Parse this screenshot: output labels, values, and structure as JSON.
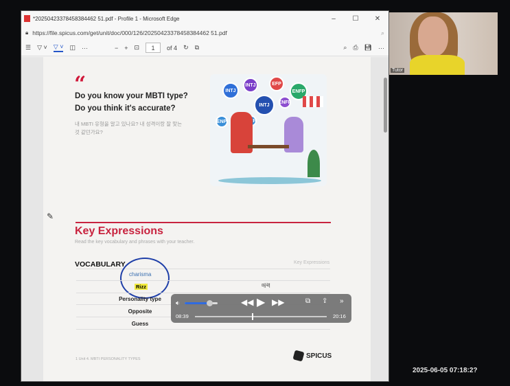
{
  "window": {
    "title": "*20250423378458384462 51.pdf - Profile 1 - Microsoft Edge",
    "url": "https://file.spicus.com/get/unit/doc/000/126/20250423378458384462 51.pdf"
  },
  "toolbar": {
    "page": "1",
    "of": "of 4"
  },
  "doc": {
    "q1": "Do you know your MBTI type?",
    "q2": "Do you think it's accurate?",
    "ko": "내 MBTI 유형을 알고 있나요? 내 성격이랑 잘 맞는 것 같던가요?",
    "bubbles": [
      "INTJ",
      "INTJ",
      "EFP",
      "ENFP",
      "INTJ",
      "ENP",
      "ENFP",
      "ENP"
    ],
    "ke_title": "Key Expressions",
    "ke_sub": "Read the key vocabulary and phrases with your teacher.",
    "vocab": "VOCABULARY",
    "ke_label": "Key Expressions",
    "annot": "charisma",
    "words": [
      "Rizz",
      "Personality type",
      "Opposite",
      "Guess"
    ],
    "meaning": "매력",
    "footer": "1   Unit 4. MBTI PERSONALITY TYPES",
    "logo": "SPICUS"
  },
  "player": {
    "current": "08:39",
    "total": "20:16",
    "progress": 0.43,
    "volume": 0.75
  },
  "cam": {
    "label": "Tutor"
  },
  "timestamp": "2025-06-05  07:18:2?"
}
